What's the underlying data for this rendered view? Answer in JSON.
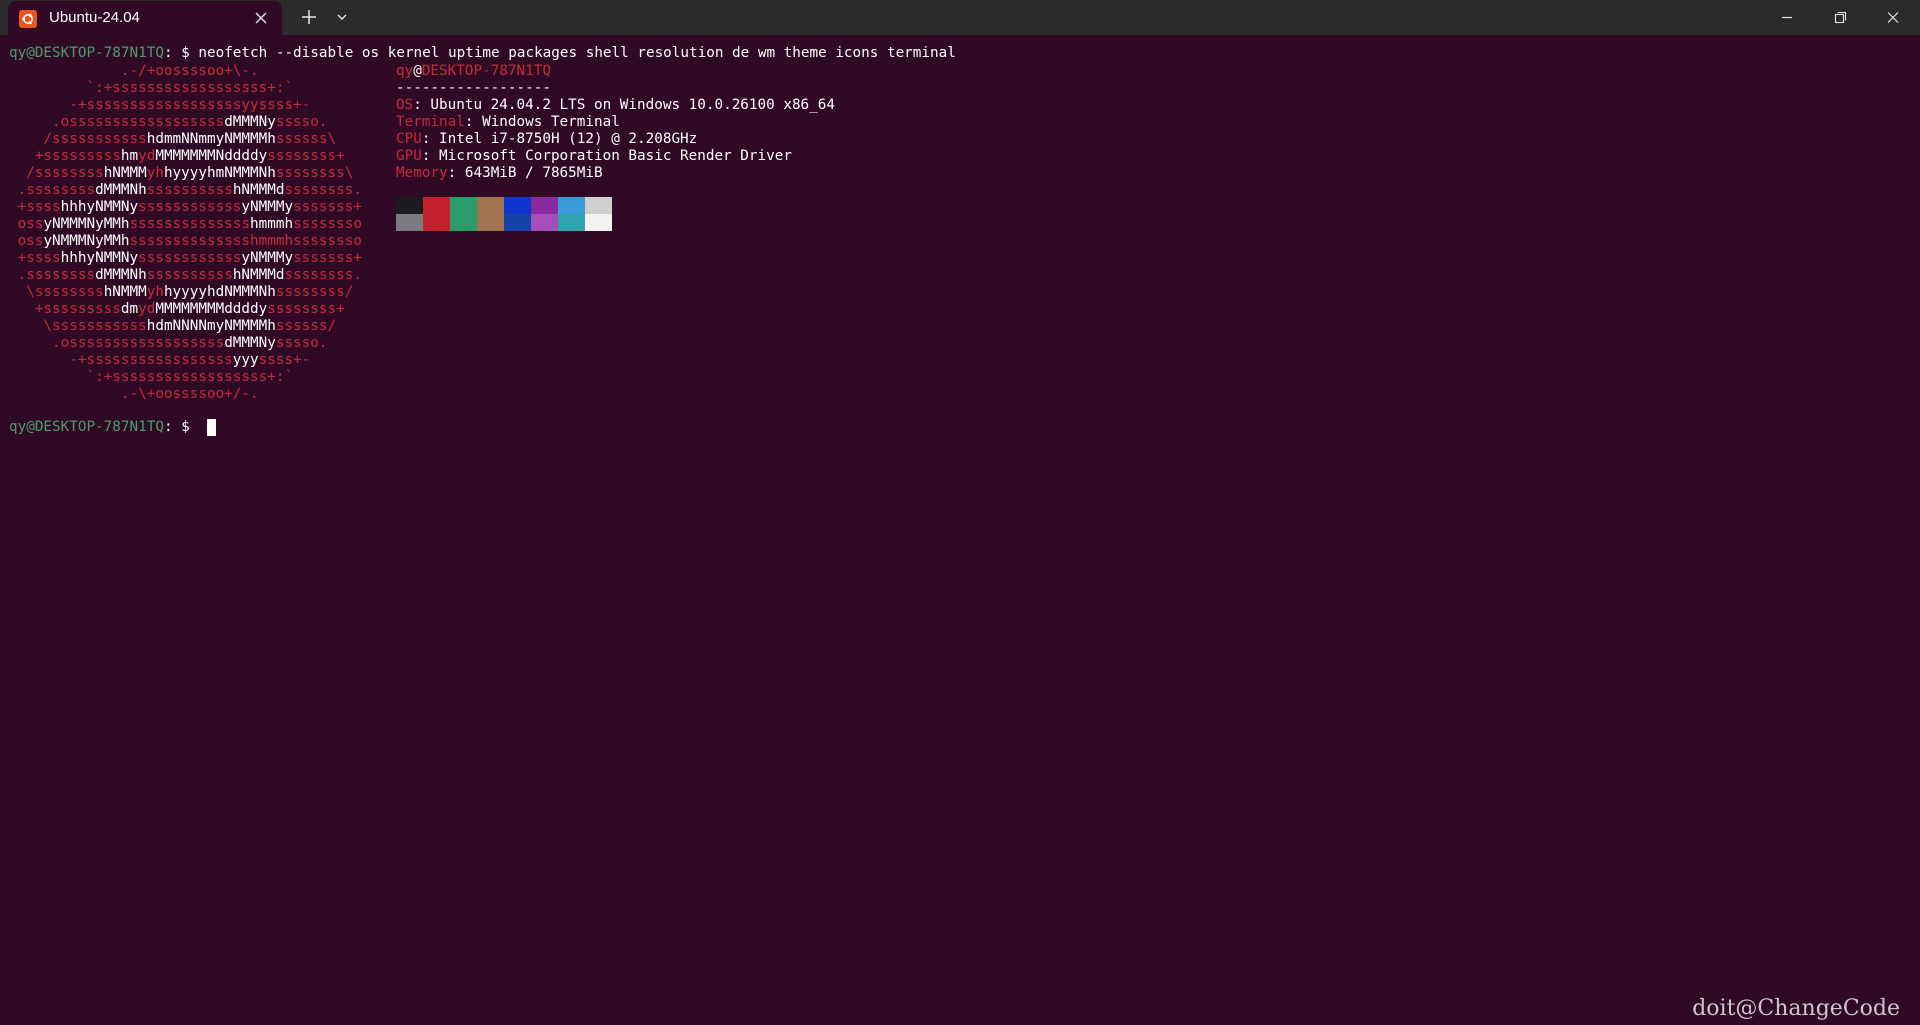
{
  "tab": {
    "title": "Ubuntu-24.04",
    "icon": "ubuntu-icon"
  },
  "toolbar": {
    "new_tab_icon": "plus-icon",
    "dropdown_icon": "chevron-down-icon"
  },
  "window_controls": {
    "minimize": "minimize-icon",
    "restore": "restore-icon",
    "close": "close-icon"
  },
  "prompt": {
    "user_host": "qy@DESKTOP-787N1TQ",
    "symbol": ": $ "
  },
  "command": "neofetch --disable os kernel uptime packages shell resolution de wm theme icons terminal",
  "logo": [
    [
      [
        "r",
        "             .-/+oossssoo+\\-.               "
      ]
    ],
    [
      [
        "r",
        "         `:+ssssssssssssssssss+:`           "
      ]
    ],
    [
      [
        "r",
        "       -+ssssssssssssssssssyyssss+-         "
      ]
    ],
    [
      [
        "r",
        "     .ossssssssssssssssss"
      ],
      [
        "w",
        "dMMMNy"
      ],
      [
        "r",
        "sssso.       "
      ]
    ],
    [
      [
        "r",
        "    /sssssssssss"
      ],
      [
        "w",
        "hdmmNNmmyNMMMMh"
      ],
      [
        "r",
        "ssssss\\      "
      ]
    ],
    [
      [
        "r",
        "   +sssssssss"
      ],
      [
        "w",
        "hm"
      ],
      [
        "r",
        "yd"
      ],
      [
        "w",
        "MMMMMMMNddddy"
      ],
      [
        "r",
        "ssssssss+     "
      ]
    ],
    [
      [
        "r",
        "  /ssssssss"
      ],
      [
        "w",
        "hNMMM"
      ],
      [
        "r",
        "yh"
      ],
      [
        "w",
        "hyyyyhmNMMMNh"
      ],
      [
        "r",
        "ssssssss\\    "
      ]
    ],
    [
      [
        "r",
        " .ssssssss"
      ],
      [
        "w",
        "dMMMNh"
      ],
      [
        "r",
        "ssssssssss"
      ],
      [
        "w",
        "hNMMMd"
      ],
      [
        "r",
        "ssssssss.    "
      ]
    ],
    [
      [
        "r",
        " +ssss"
      ],
      [
        "w",
        "hhhyNMMNy"
      ],
      [
        "r",
        "ssssssssssss"
      ],
      [
        "w",
        "yNMMMy"
      ],
      [
        "r",
        "sssssss+    "
      ]
    ],
    [
      [
        "r",
        " oss"
      ],
      [
        "w",
        "yNMMMNyMMh"
      ],
      [
        "r",
        "ssssssssssssss"
      ],
      [
        "w",
        "hmmmh"
      ],
      [
        "r",
        "ssssssso    "
      ]
    ],
    [
      [
        "r",
        " oss"
      ],
      [
        "w",
        "yNMMMNyMMh"
      ],
      [
        "r",
        "sssssssssssssshmmmhssssssso    "
      ]
    ],
    [
      [
        "r",
        " +ssss"
      ],
      [
        "w",
        "hhhyNMMNy"
      ],
      [
        "r",
        "ssssssssssss"
      ],
      [
        "w",
        "yNMMMy"
      ],
      [
        "r",
        "sssssss+    "
      ]
    ],
    [
      [
        "r",
        " .ssssssss"
      ],
      [
        "w",
        "dMMMNh"
      ],
      [
        "r",
        "ssssssssss"
      ],
      [
        "w",
        "hNMMMd"
      ],
      [
        "r",
        "ssssssss.    "
      ]
    ],
    [
      [
        "r",
        "  \\ssssssss"
      ],
      [
        "w",
        "hNMMM"
      ],
      [
        "r",
        "yh"
      ],
      [
        "w",
        "hyyyyhdNMMMNh"
      ],
      [
        "r",
        "ssssssss/    "
      ]
    ],
    [
      [
        "r",
        "   +sssssssss"
      ],
      [
        "w",
        "dm"
      ],
      [
        "r",
        "yd"
      ],
      [
        "w",
        "MMMMMMMMddddy"
      ],
      [
        "r",
        "ssssssss+     "
      ]
    ],
    [
      [
        "r",
        "    \\sssssssssss"
      ],
      [
        "w",
        "hdmNNNNmyNMMMMh"
      ],
      [
        "r",
        "ssssss/      "
      ]
    ],
    [
      [
        "r",
        "     .ossssssssssssssssss"
      ],
      [
        "w",
        "dMMMNy"
      ],
      [
        "r",
        "sssso.       "
      ]
    ],
    [
      [
        "r",
        "       -+sssssssssssssssss"
      ],
      [
        "w",
        "yyy"
      ],
      [
        "r",
        "ssss+-         "
      ]
    ],
    [
      [
        "r",
        "         `:+ssssssssssssssssss+:`           "
      ]
    ],
    [
      [
        "r",
        "             .-\\+oossssoo+/-.               "
      ]
    ]
  ],
  "info": {
    "header_user": "qy",
    "header_at": "@",
    "header_host": "DESKTOP-787N1TQ",
    "separator": "------------------",
    "rows": [
      {
        "key": "OS",
        "value": ": Ubuntu 24.04.2 LTS on Windows 10.0.26100 x86_64"
      },
      {
        "key": "Terminal",
        "value": ": Windows Terminal"
      },
      {
        "key": "CPU",
        "value": ": Intel i7-8750H (12) @ 2.208GHz"
      },
      {
        "key": "GPU",
        "value": ": Microsoft Corporation Basic Render Driver"
      },
      {
        "key": "Memory",
        "value": ": 643MiB / 7865MiB"
      }
    ]
  },
  "palette": {
    "normal": [
      "#171421",
      "#c01c28",
      "#26a269",
      "#a2734c",
      "#12488b",
      "#a347ba",
      "#2aa1b3",
      "#d0cfcc"
    ],
    "bright": [
      "#5e5c64",
      "#f66151",
      "#33da7a",
      "#e9ad0c",
      "#2a7bde",
      "#c061cb",
      "#33c7de",
      "#ffffff"
    ]
  },
  "palette_shown": {
    "normal": [
      "#1a1a1f",
      "#c4212f",
      "#2a9d6a",
      "#a27350",
      "#0b35cc",
      "#8b2aa0",
      "#3a9bd8",
      "#d0cfd0"
    ],
    "bright": [
      "#7a7a80",
      "#c4212f",
      "#2a9d6a",
      "#a27350",
      "#1543a6",
      "#a64fbb",
      "#2fa3b0",
      "#f2f2f2"
    ]
  },
  "watermark": "doit@ChangeCode"
}
